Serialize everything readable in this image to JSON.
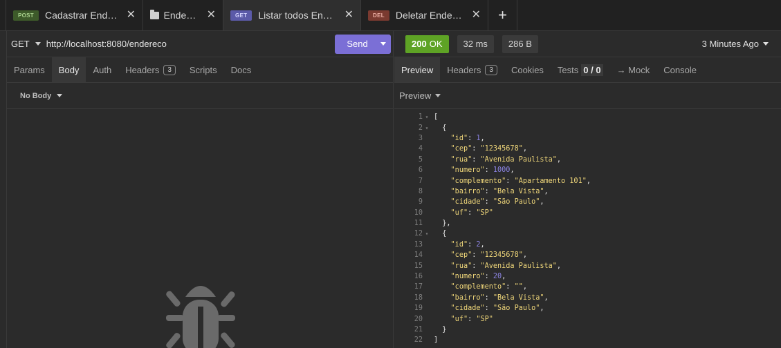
{
  "tabs": [
    {
      "method": "POST",
      "label": "Cadastrar Endereco",
      "kind": "post"
    },
    {
      "method": "",
      "label": "Endereco",
      "kind": "folder"
    },
    {
      "method": "GET",
      "label": "Listar todos Ender...",
      "kind": "get",
      "active": true
    },
    {
      "method": "DEL",
      "label": "Deletar Endereco",
      "kind": "del"
    }
  ],
  "add_tab_label": "+",
  "close_glyph": "✕",
  "request": {
    "method": "GET",
    "url": "http://localhost:8080/endereco",
    "send_label": "Send",
    "subtabs": [
      {
        "label": "Params"
      },
      {
        "label": "Body",
        "active": true
      },
      {
        "label": "Auth"
      },
      {
        "label": "Headers",
        "badge": "3"
      },
      {
        "label": "Scripts"
      },
      {
        "label": "Docs"
      }
    ],
    "body_type": "No Body"
  },
  "response": {
    "status_code": "200",
    "status_text": "OK",
    "time": "32 ms",
    "size": "286 B",
    "ago": "3 Minutes Ago",
    "subtabs": {
      "preview": "Preview",
      "headers": "Headers",
      "headers_badge": "3",
      "cookies": "Cookies",
      "tests": "Tests",
      "tests_count": "0 / 0",
      "mock": "→ Mock",
      "console": "Console"
    },
    "preview_mode": "Preview",
    "items": [
      {
        "id": 1,
        "cep": "12345678",
        "rua": "Avenida Paulista",
        "numero": 1000,
        "complemento": "Apartamento 101",
        "bairro": "Bela Vista",
        "cidade": "São Paulo",
        "uf": "SP"
      },
      {
        "id": 2,
        "cep": "12345678",
        "rua": "Avenida Paulista",
        "numero": 20,
        "complemento": "",
        "bairro": "Bela Vista",
        "cidade": "São Paulo",
        "uf": "SP"
      }
    ]
  },
  "colors": {
    "accent": "#7b6fd6",
    "status_ok": "#5ea325",
    "json_string": "#f0d77a",
    "json_number": "#8d85e6"
  }
}
